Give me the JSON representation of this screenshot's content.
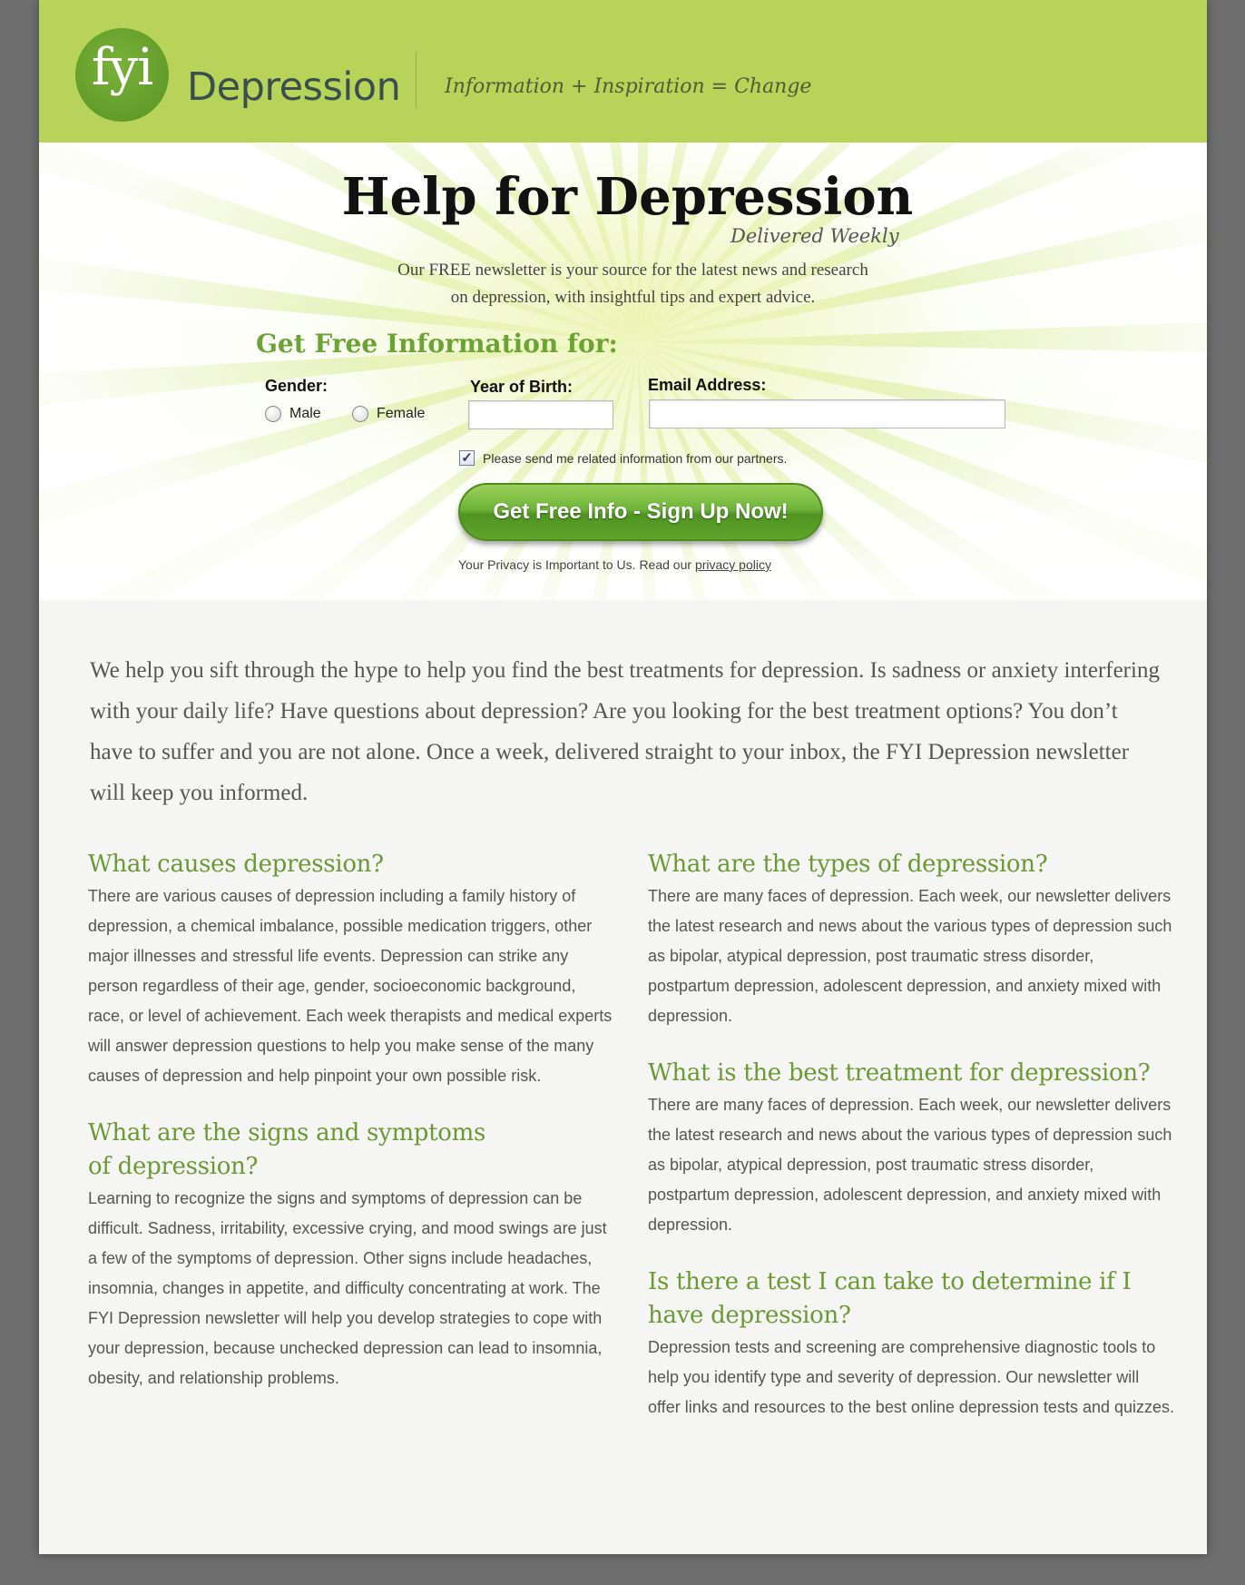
{
  "header": {
    "logo_text": "fyi",
    "brand": "Depression",
    "tagline": "Information + Inspiration = Change"
  },
  "hero": {
    "title": "Help for Depression",
    "subtitle": "Delivered Weekly",
    "description_line1": "Our FREE newsletter is your source for the latest news and research",
    "description_line2": "on depression, with insightful tips and expert advice."
  },
  "form": {
    "heading": "Get Free Information for:",
    "gender_label": "Gender:",
    "male_label": "Male",
    "female_label": "Female",
    "year_label": "Year of Birth:",
    "year_value": "",
    "email_label": "Email Address:",
    "email_value": "",
    "partners_checked": true,
    "partners_label": "Please send me related information from our partners.",
    "submit_label": "Get Free Info - Sign Up Now!",
    "privacy_text": "Your Privacy is Important to Us. Read our ",
    "privacy_link": "privacy policy"
  },
  "intro": "We help you sift through the hype to help you find the best treatments for depression. Is sadness or anxiety interfering with your daily life? Have questions about depression? Are you looking for the best treatment options? You don’t have to suffer and you are not alone. Once a week, delivered straight to your inbox, the FYI Depression newsletter will keep you informed.",
  "sections_left": [
    {
      "title": "What causes depression?",
      "body": "There are various causes of depression including a family history of depression, a chemical imbalance, possible medication triggers, other major illnesses and stressful life events. Depression can strike any person regardless of their age, gender, socioeconomic background, race, or level of achievement. Each week therapists and medical experts will answer  depression questions to help you make sense of the many causes of depression and help pinpoint your own possible risk."
    },
    {
      "title": "What are the signs and symptoms of depression?",
      "body": "Learning to recognize the signs and symptoms of depression can be difficult. Sadness, irritability, excessive crying, and mood swings are just a few of the symptoms of depression. Other signs include headaches, insomnia, changes in appetite, and difficulty concentrating at work. The FYI Depression newsletter will help you develop strategies to cope with your depression, because unchecked depression can lead to insomnia, obesity, and relationship problems."
    }
  ],
  "sections_right": [
    {
      "title": "What are the types of depression?",
      "body": "There are many faces of depression. Each week, our newsletter delivers the latest research and news about the various types of depression such as bipolar, atypical depression, post traumatic stress disorder, postpartum depression, adolescent depression, and anxiety mixed with depression."
    },
    {
      "title": "What is the best treatment for depression?",
      "body": "There are many faces of depression. Each week, our newsletter delivers the latest research and news about the various types of depression such as bipolar, atypical depression, post traumatic stress disorder, postpartum depression, adolescent depression, and anxiety mixed with depression."
    },
    {
      "title": "Is there a test I can take to determine if I have depression?",
      "body": "Depression tests and screening are comprehensive diagnostic tools to help you identify type and severity of depression. Our newsletter will offer links and resources to the best online depression tests and quizzes."
    }
  ],
  "colors": {
    "header_green": "#b8d35a",
    "logo_green": "#6aa433",
    "heading_green": "#6a9a33",
    "page_background": "#f5f6f4",
    "outer_background": "#6e6e6e"
  }
}
